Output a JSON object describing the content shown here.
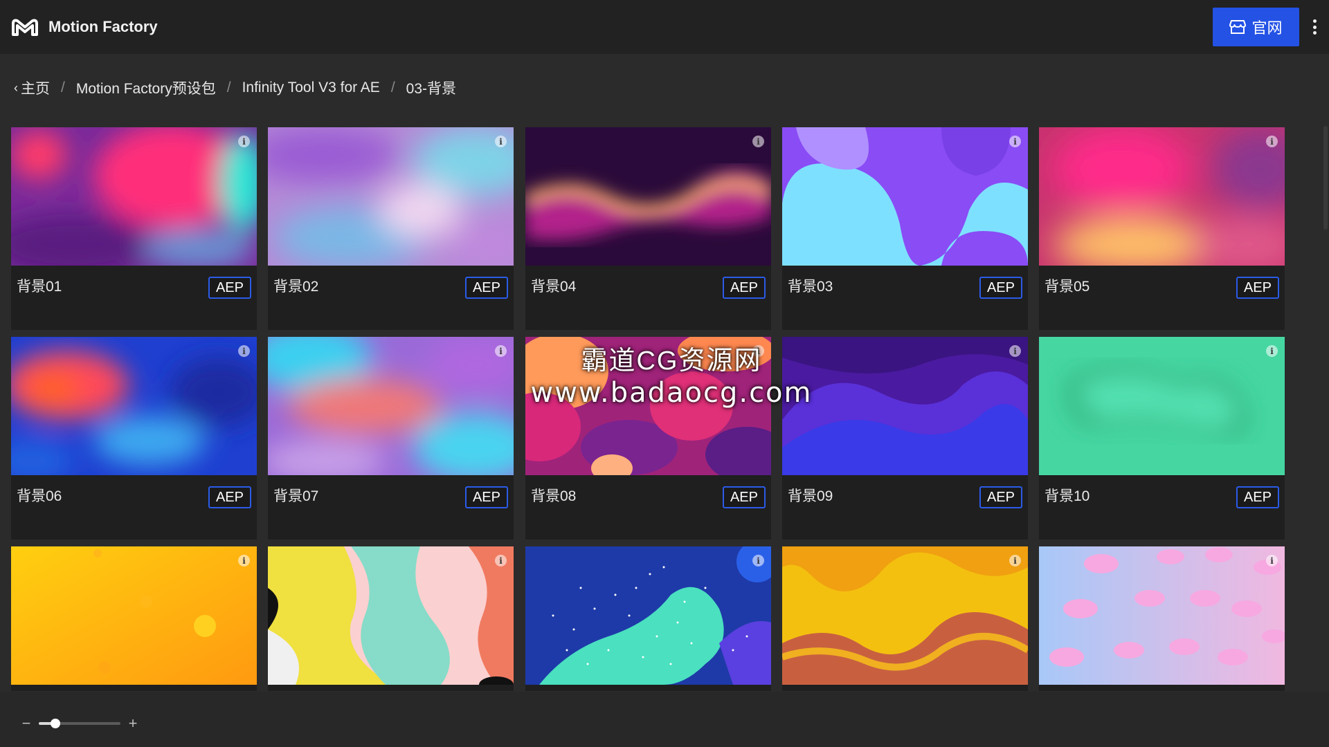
{
  "app": {
    "name": "Motion Factory",
    "site_button_label": "官网"
  },
  "breadcrumb": [
    {
      "label": "主页"
    },
    {
      "label": "Motion Factory预设包"
    },
    {
      "label": "Infinity Tool V3 for AE"
    },
    {
      "label": "03-背景"
    }
  ],
  "breadcrumb_separator": "/",
  "back_glyph": "‹",
  "info_glyph": "i",
  "cards": [
    {
      "title": "背景01",
      "badge": "AEP",
      "thumb": "bg01"
    },
    {
      "title": "背景02",
      "badge": "AEP",
      "thumb": "bg02"
    },
    {
      "title": "背景04",
      "badge": "AEP",
      "thumb": "bg04"
    },
    {
      "title": "背景03",
      "badge": "AEP",
      "thumb": "bg03"
    },
    {
      "title": "背景05",
      "badge": "AEP",
      "thumb": "bg05"
    },
    {
      "title": "背景06",
      "badge": "AEP",
      "thumb": "bg06"
    },
    {
      "title": "背景07",
      "badge": "AEP",
      "thumb": "bg07"
    },
    {
      "title": "背景08",
      "badge": "AEP",
      "thumb": "bg08"
    },
    {
      "title": "背景09",
      "badge": "AEP",
      "thumb": "bg09"
    },
    {
      "title": "背景10",
      "badge": "AEP",
      "thumb": "bg10"
    },
    {
      "title": "",
      "badge": "",
      "thumb": "bg11"
    },
    {
      "title": "",
      "badge": "",
      "thumb": "bg12"
    },
    {
      "title": "",
      "badge": "",
      "thumb": "bg13"
    },
    {
      "title": "",
      "badge": "",
      "thumb": "bg14"
    },
    {
      "title": "",
      "badge": "",
      "thumb": "bg15"
    }
  ],
  "zoom": {
    "minus_glyph": "−",
    "plus_glyph": "+",
    "level": 0.2
  },
  "watermark": {
    "line1": "霸道CG资源网",
    "line2": "www.badaocg.com"
  },
  "colors": {
    "accent": "#2352e5",
    "badge_border": "#2b5be8",
    "topbar_bg": "#222222",
    "page_bg": "#2b2b2b",
    "card_bg": "#1f1f1f"
  }
}
